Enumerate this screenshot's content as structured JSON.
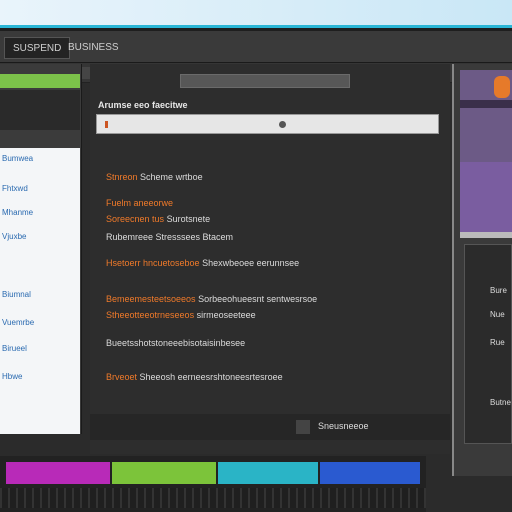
{
  "window": {
    "tabs": [
      "SUSPEND",
      "BUSINESS"
    ]
  },
  "left_panel": {
    "items": [
      "Bumwea",
      "Fhtxwd",
      "Mhanme",
      "Vjuxbe",
      "Biumnal",
      "Vuemrbe",
      "Birueel",
      "Hbwe"
    ]
  },
  "center": {
    "heading": "Arumse eeo faecitwe",
    "lines": [
      {
        "orange": "Stnreon",
        "white": "Scheme wrtboe"
      },
      {
        "orange": "Fuelm aneeorwe",
        "white": ""
      },
      {
        "orange": "Soreecnen tus",
        "white": "Surotsnete"
      },
      {
        "orange": "",
        "white": "Rubemreee Stresssees Btacem"
      },
      {
        "orange": "Hsetoerr hncuetoseboe",
        "white": "Shexwbeoee eerunnsee"
      },
      {
        "orange": "Bemeemesteetsoeeos",
        "white": "Sorbeeohueesnt sentwesrsoe"
      },
      {
        "orange": "Stheeotteeotrneseeos",
        "white": "sirmeoseeteee"
      },
      {
        "orange": "",
        "white": "Bueetsshotstoneeebisotaisinbesee"
      },
      {
        "orange": "Brveoet",
        "white": "Sheeosh eerneesrshtoneesrtesroee"
      }
    ],
    "footer_label": "Sneusneeoe"
  },
  "right_panel": {
    "labels": [
      "Bure",
      "Nue",
      "Rue",
      "Butne"
    ]
  },
  "timeline": {
    "clips": [
      {
        "color": "#b82ab8"
      },
      {
        "color": "#7cc43a"
      },
      {
        "color": "#2ab4c6"
      },
      {
        "color": "#2a5ad0"
      }
    ]
  },
  "colors": {
    "accent_orange": "#f07a2a",
    "accent_green": "#7cc24a",
    "link_blue": "#2a6ab0"
  }
}
